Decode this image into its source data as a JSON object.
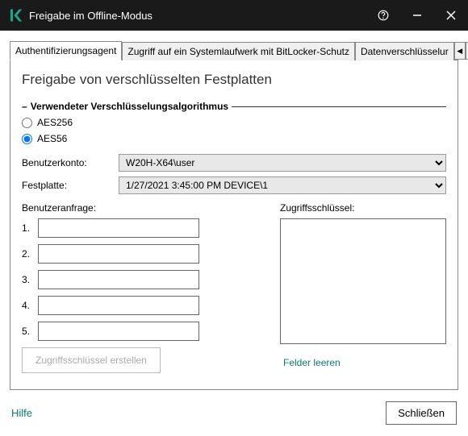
{
  "window": {
    "title": "Freigabe im Offline-Modus"
  },
  "tabs": {
    "items": [
      "Authentifizierungsagent",
      "Zugriff auf ein Systemlaufwerk mit BitLocker-Schutz",
      "Datenverschlüsselur"
    ],
    "active": 0
  },
  "page": {
    "title": "Freigabe von verschlüsselten Festplatten"
  },
  "algo": {
    "group_label": "Verwendeter Verschlüsselungsalgorithmus",
    "opt1": "AES256",
    "opt2": "AES56",
    "selected": "AES56"
  },
  "account": {
    "label": "Benutzerkonto:",
    "value": "W20H-X64\\user"
  },
  "disk": {
    "label": "Festplatte:",
    "value": "1/27/2021 3:45:00 PM  DEVICE\\1"
  },
  "request": {
    "label": "Benutzeranfrage:",
    "rows": [
      "1.",
      "2.",
      "3.",
      "4.",
      "5."
    ]
  },
  "access": {
    "label": "Zugriffsschlüssel:"
  },
  "buttons": {
    "create": "Zugriffsschlüssel erstellen",
    "clear": "Felder leeren"
  },
  "footer": {
    "help": "Hilfe",
    "close": "Schließen"
  }
}
